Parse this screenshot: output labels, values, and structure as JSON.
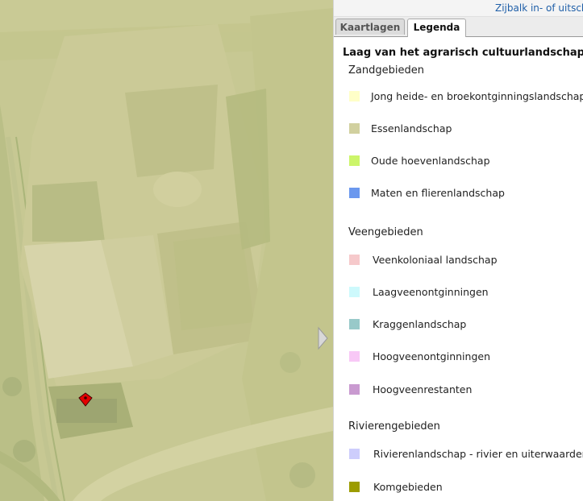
{
  "panel": {
    "toggle_link": "Zijbalk in- of uitschuiven",
    "tabs": [
      {
        "label": "Kaartlagen",
        "active": false
      },
      {
        "label": "Legenda",
        "active": true
      }
    ]
  },
  "legend": {
    "title": "Laag van het agrarisch cultuurlandschap",
    "groups": [
      {
        "title": "Zandgebieden",
        "items": [
          {
            "label": "Jong heide- en broekontginningslandschap",
            "color": "#ffffc8"
          },
          {
            "label": "Essenlandschap",
            "color": "#d1d09f"
          },
          {
            "label": "Oude hoevenlandschap",
            "color": "#ccf56a"
          },
          {
            "label": "Maten en flierenlandschap",
            "color": "#6b98ee"
          }
        ]
      },
      {
        "title": "Veengebieden",
        "items": [
          {
            "label": "Veenkoloniaal landschap",
            "color": "#f6c9cb"
          },
          {
            "label": "Laagveenontginningen",
            "color": "#cdf9fc"
          },
          {
            "label": "Kraggenlandschap",
            "color": "#98c9c9"
          },
          {
            "label": "Hoogveenontginningen",
            "color": "#f8c8f6"
          },
          {
            "label": "Hoogveenrestanten",
            "color": "#c99ad0"
          }
        ]
      },
      {
        "title": "Rivierengebieden",
        "items": [
          {
            "label": "Rivierenlandschap - rivier en uiterwaarden",
            "color": "#cdcdfc"
          },
          {
            "label": "Komgebieden",
            "color": "#9c9c00"
          }
        ]
      }
    ]
  },
  "map": {
    "overlay_color": "#c9c893"
  }
}
